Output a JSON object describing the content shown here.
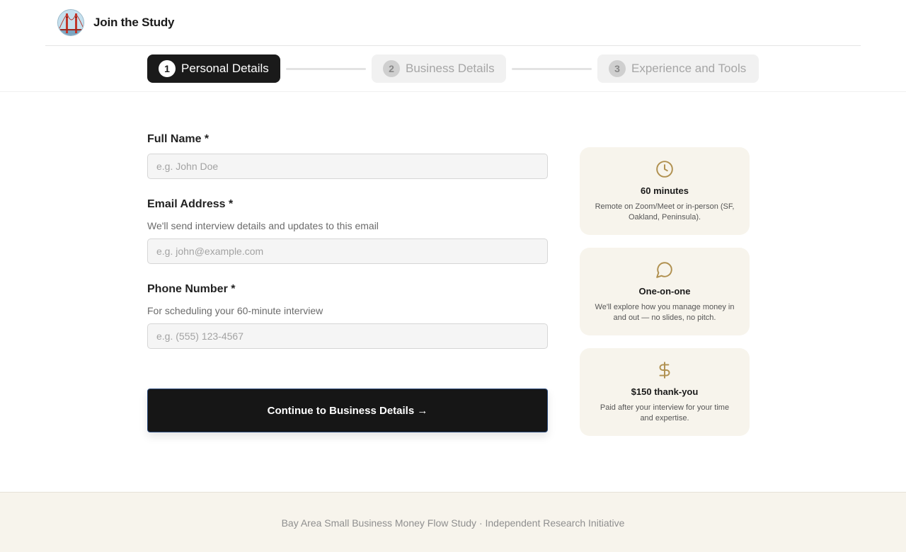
{
  "header": {
    "brand": "Join the Study",
    "logo_icon": "golden-gate-bridge-icon"
  },
  "stepper": {
    "steps": [
      {
        "number": "1",
        "label": "Personal Details",
        "state": "active"
      },
      {
        "number": "2",
        "label": "Business Details",
        "state": "inactive"
      },
      {
        "number": "3",
        "label": "Experience and Tools",
        "state": "inactive"
      }
    ]
  },
  "form": {
    "full_name": {
      "label": "Full Name *",
      "placeholder": "e.g. John Doe",
      "value": ""
    },
    "email": {
      "label": "Email Address *",
      "help": "We'll send interview details and updates to this email",
      "placeholder": "e.g. john@example.com",
      "value": ""
    },
    "phone": {
      "label": "Phone Number *",
      "help": "For scheduling your 60-minute interview",
      "placeholder": "e.g. (555) 123-4567",
      "value": ""
    },
    "submit_label": "Continue to Business Details →"
  },
  "info_cards": [
    {
      "icon": "clock-icon",
      "title": "60 minutes",
      "desc": "Remote on Zoom/Meet or in-person (SF, Oakland, Peninsula)."
    },
    {
      "icon": "chat-bubble-icon",
      "title": "One-on-one",
      "desc": "We'll explore how you manage money in and out — no slides, no pitch."
    },
    {
      "icon": "dollar-icon",
      "title": "$150 thank-you",
      "desc": "Paid after your interview for your time and expertise."
    }
  ],
  "footer": {
    "text": "Bay Area Small Business Money Flow Study · Independent Research Initiative"
  },
  "colors": {
    "accent": "#1a1a1a",
    "card_bg": "#f7f4ec",
    "icon_gold": "#b0904f"
  }
}
